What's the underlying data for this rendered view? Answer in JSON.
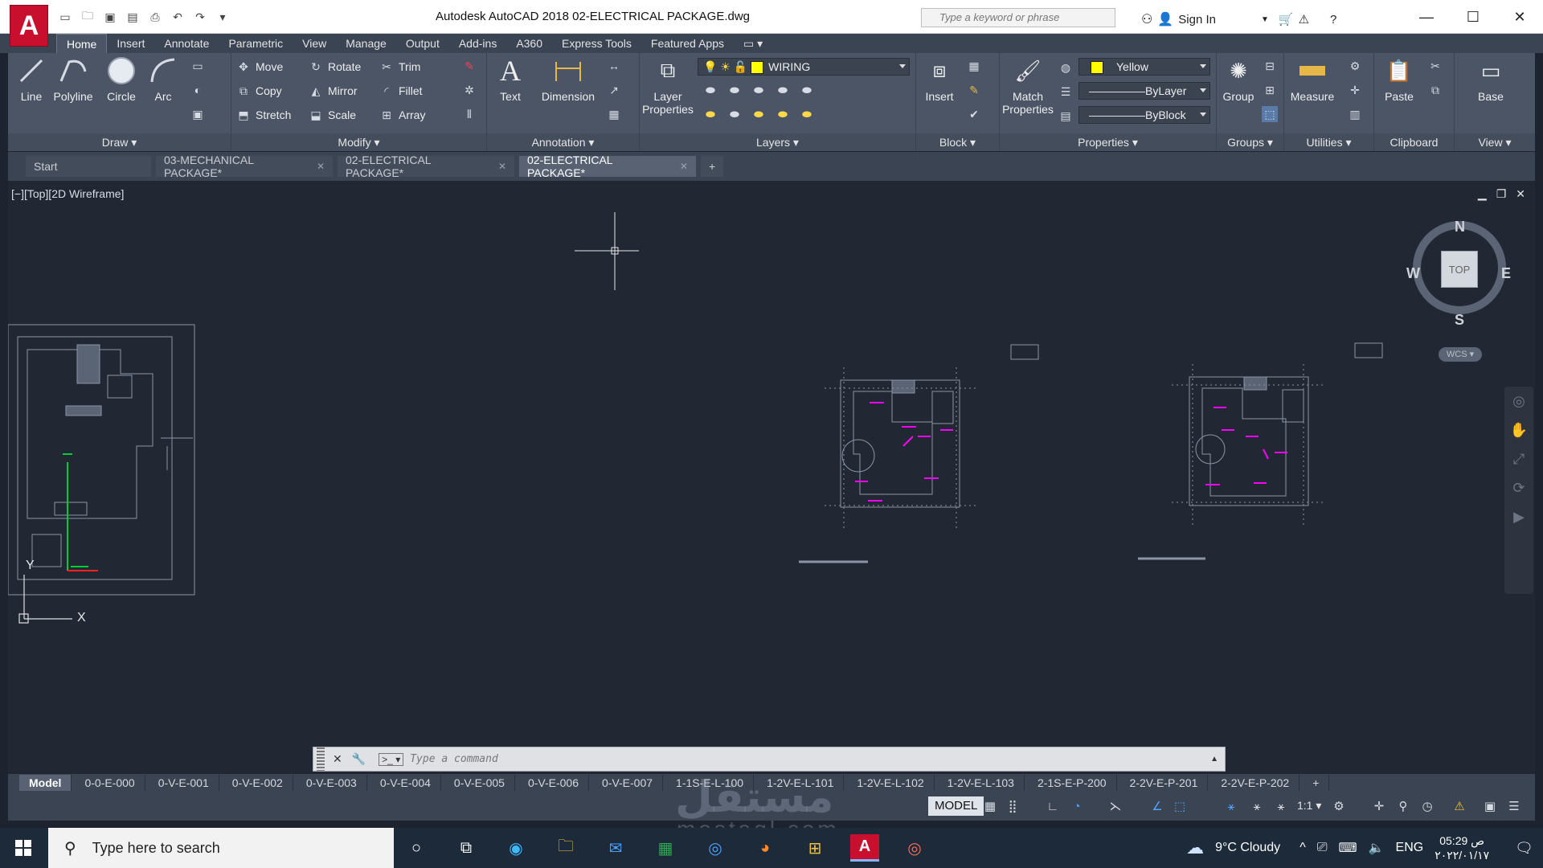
{
  "window": {
    "logo_letter": "A",
    "title": "Autodesk AutoCAD 2018     02-ELECTRICAL PACKAGE.dwg",
    "search_placeholder": "Type a keyword or phrase",
    "signin": "Sign In"
  },
  "ribbon_tabs": [
    "Home",
    "Insert",
    "Annotate",
    "Parametric",
    "View",
    "Manage",
    "Output",
    "Add-ins",
    "A360",
    "Express Tools",
    "Featured Apps"
  ],
  "ribbon": {
    "draw": {
      "title": "Draw",
      "line": "Line",
      "polyline": "Polyline",
      "circle": "Circle",
      "arc": "Arc"
    },
    "modify": {
      "title": "Modify",
      "move": "Move",
      "rotate": "Rotate",
      "trim": "Trim",
      "copy": "Copy",
      "mirror": "Mirror",
      "fillet": "Fillet",
      "stretch": "Stretch",
      "scale": "Scale",
      "array": "Array"
    },
    "annotation": {
      "title": "Annotation",
      "text": "Text",
      "dimension": "Dimension"
    },
    "layers": {
      "title": "Layers",
      "layer_properties_1": "Layer",
      "layer_properties_2": "Properties",
      "current_layer": "WIRING"
    },
    "block": {
      "title": "Block",
      "insert": "Insert"
    },
    "properties": {
      "title": "Properties",
      "match_1": "Match",
      "match_2": "Properties",
      "color": "Yellow",
      "linetype": "ByLayer",
      "lineweight": "ByBlock"
    },
    "groups": {
      "title": "Groups",
      "group": "Group"
    },
    "utilities": {
      "title": "Utilities",
      "measure": "Measure"
    },
    "clipboard": {
      "title": "Clipboard",
      "paste": "Paste"
    },
    "view": {
      "title": "View",
      "base": "Base"
    }
  },
  "file_tabs": [
    {
      "label": "Start"
    },
    {
      "label": "03-MECHANICAL PACKAGE*"
    },
    {
      "label": "02-ELECTRICAL PACKAGE*"
    },
    {
      "label": "02-ELECTRICAL PACKAGE*"
    }
  ],
  "viewport": {
    "label": "[−][Top][2D Wireframe]",
    "compass": {
      "n": "N",
      "s": "S",
      "e": "E",
      "w": "W",
      "top": "TOP",
      "wcs": "WCS"
    },
    "ucs_x": "X",
    "ucs_y": "Y"
  },
  "command": {
    "placeholder": "Type a command"
  },
  "layout_tabs": [
    "Model",
    "0-0-E-000",
    "0-V-E-001",
    "0-V-E-002",
    "0-V-E-003",
    "0-V-E-004",
    "0-V-E-005",
    "0-V-E-006",
    "0-V-E-007",
    "1-1S-E-L-100",
    "1-2V-E-L-101",
    "1-2V-E-L-102",
    "1-2V-E-L-103",
    "2-1S-E-P-200",
    "2-2V-E-P-201",
    "2-2V-E-P-202"
  ],
  "status": {
    "model": "MODEL",
    "scale": "1:1"
  },
  "taskbar": {
    "search": "Type here to search",
    "weather": "9°C  Cloudy",
    "lang": "ENG",
    "time": "05:29 ص",
    "date": "٢٠٢٢/٠١/١٧"
  },
  "watermark": {
    "arabic": "مستقل",
    "latin": "mostaql.com"
  },
  "colors": {
    "accent_red": "#c8102e",
    "canvas": "#212834",
    "ribbon": "#4b5566",
    "layer_yellow": "#ffff00",
    "wiring_magenta": "#ff00ff"
  }
}
